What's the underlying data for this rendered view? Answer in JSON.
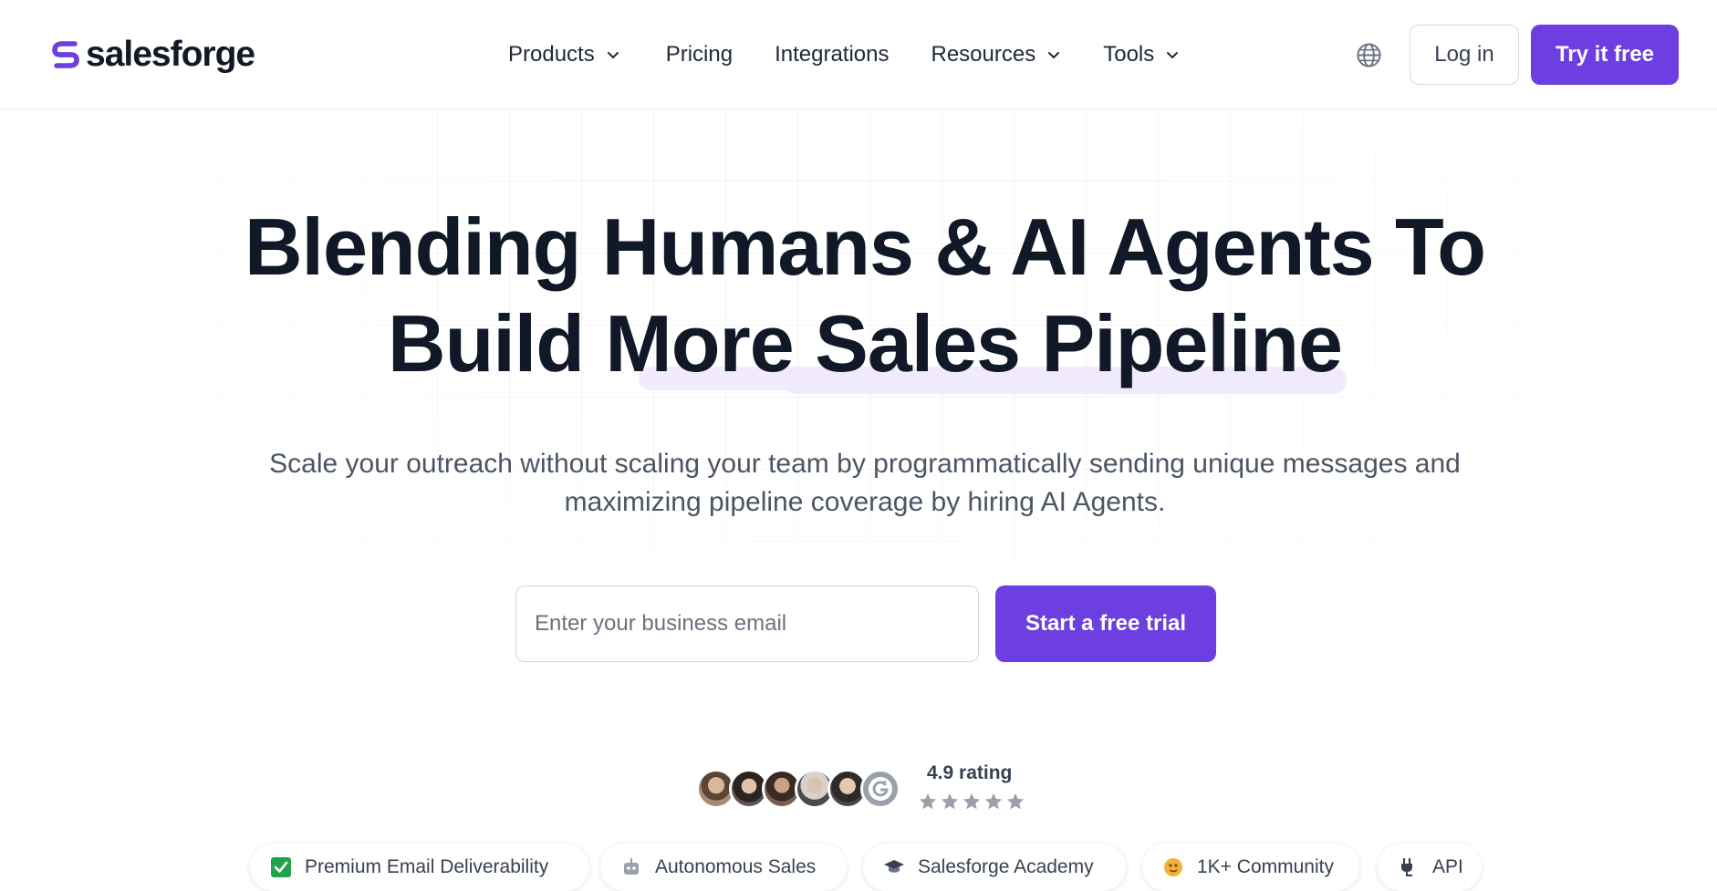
{
  "header": {
    "logo_text": "salesforge",
    "nav": [
      {
        "label": "Products",
        "has_dropdown": true
      },
      {
        "label": "Pricing",
        "has_dropdown": false
      },
      {
        "label": "Integrations",
        "has_dropdown": false
      },
      {
        "label": "Resources",
        "has_dropdown": true
      },
      {
        "label": "Tools",
        "has_dropdown": true
      }
    ],
    "language_icon": "globe-icon",
    "login_label": "Log in",
    "try_label": "Try it free"
  },
  "hero": {
    "headline_line1": "Blending Humans & AI Agents To",
    "headline_line2": "Build More Sales Pipeline",
    "subline_line1": "Scale your outreach without scaling your team by programmatically sending unique messages and",
    "subline_line2": "maximizing pipeline coverage by hiring AI Agents.",
    "email_placeholder": "Enter your business email",
    "email_value": "",
    "cta_label": "Start a free trial"
  },
  "social_proof": {
    "rating_label": "4.9 rating",
    "stars": 5,
    "avatars": [
      "avatar-1",
      "avatar-2",
      "avatar-3",
      "avatar-4",
      "avatar-5",
      "g2-badge"
    ]
  },
  "features": [
    {
      "label": "Premium Email Deliverability",
      "icon": "check-box-icon"
    },
    {
      "label": "Autonomous Sales",
      "icon": "robot-icon"
    },
    {
      "label": "Salesforge Academy",
      "icon": "graduation-cap-icon"
    },
    {
      "label": "1K+ Community",
      "icon": "community-icon"
    },
    {
      "label": "API",
      "icon": "plug-icon"
    }
  ],
  "colors": {
    "brand_purple": "#6d3fe0",
    "headline_text": "#111827",
    "highlight": "#f1e9fd"
  }
}
